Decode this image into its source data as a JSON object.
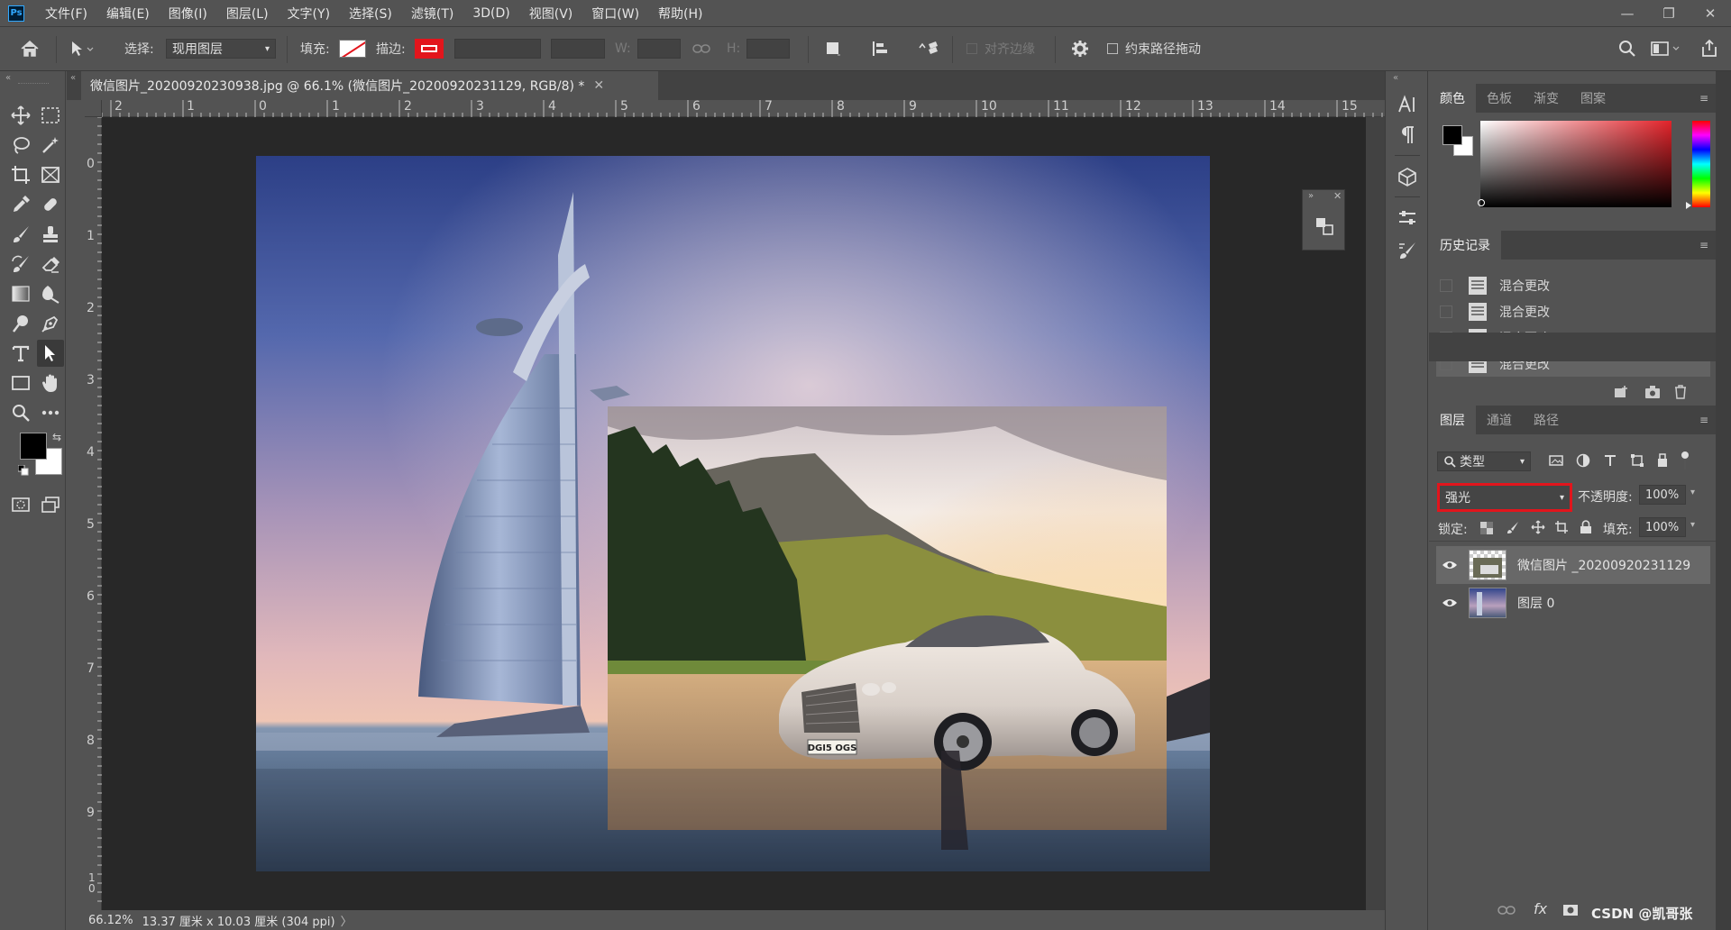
{
  "menubar": {
    "logo": "Ps",
    "items": [
      "文件(F)",
      "编辑(E)",
      "图像(I)",
      "图层(L)",
      "文字(Y)",
      "选择(S)",
      "滤镜(T)",
      "3D(D)",
      "视图(V)",
      "窗口(W)",
      "帮助(H)"
    ],
    "window_controls": [
      "—",
      "❐",
      "✕"
    ]
  },
  "options": {
    "select_label": "选择:",
    "select_value": "现用图层",
    "fill_label": "填充:",
    "stroke_label": "描边:",
    "w_label": "W:",
    "h_label": "H:",
    "align_edges": "对齐边缘",
    "constrain_path": "约束路径拖动"
  },
  "document": {
    "tab_title": "微信图片_20200920230938.jpg @ 66.1% (微信图片_20200920231129, RGB/8) *",
    "close": "✕"
  },
  "rulers": {
    "top": [
      "2",
      "1",
      "0",
      "1",
      "2",
      "3",
      "4",
      "5",
      "6",
      "7",
      "8",
      "9",
      "10",
      "11",
      "12",
      "13",
      "14",
      "15"
    ],
    "left": [
      "0",
      "1",
      "2",
      "3",
      "4",
      "5",
      "6",
      "7",
      "8",
      "9",
      "1\n0"
    ]
  },
  "status": {
    "zoom": "66.12%",
    "info": "13.37 厘米 x 10.03 厘米 (304 ppi)",
    "arrow": "〉"
  },
  "color_panel": {
    "tabs": [
      "颜色",
      "色板",
      "渐变",
      "图案"
    ],
    "foreground": "#000000",
    "background": "#ffffff",
    "picker_hue": "#e3232a"
  },
  "history_panel": {
    "title": "历史记录",
    "items": [
      "混合更改",
      "混合更改",
      "混合更改",
      "混合更改"
    ]
  },
  "layers_panel": {
    "tabs": [
      "图层",
      "通道",
      "路径"
    ],
    "filter_label": "类型",
    "blend_mode": "强光",
    "opacity_label": "不透明度:",
    "opacity_value": "100%",
    "lock_label": "锁定:",
    "fill_label": "填充:",
    "fill_value": "100%",
    "layers": [
      {
        "name": "微信图片 _20200920231129",
        "visible": true,
        "selected": true
      },
      {
        "name": "图层 0",
        "visible": true,
        "selected": false
      }
    ],
    "footer_watermark": "CSDN @凯哥张",
    "footer_fx": "fx"
  },
  "artwork": {
    "license_plate": "DGI5 OGS"
  },
  "colors": {
    "accent_red": "#e2151c",
    "panel_bg": "#535353",
    "canvas_bg": "#282828"
  }
}
